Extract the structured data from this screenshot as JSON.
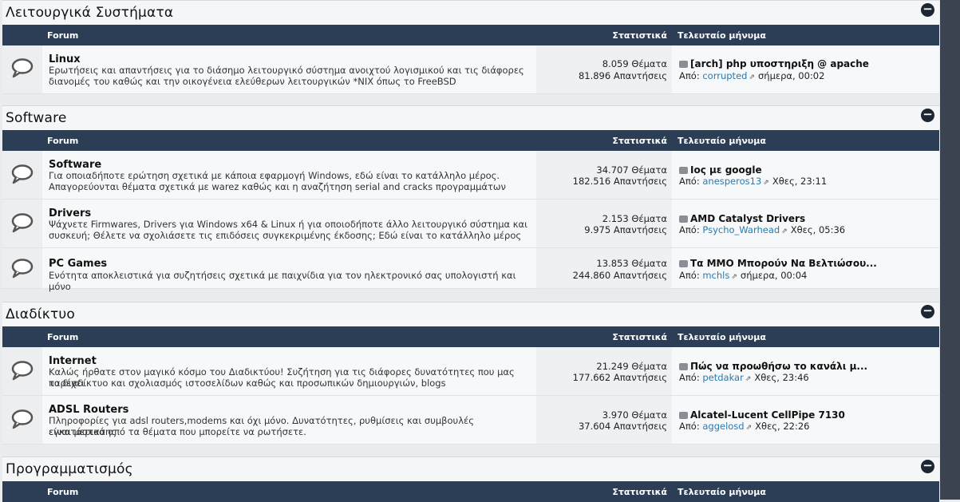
{
  "header_cols": {
    "forum": "Forum",
    "stats": "Στατιστικά",
    "last": "Τελευταίο μήνυμα"
  },
  "last_prefix": "Από:",
  "categories": [
    {
      "title": "Λειτουργικά Συστήματα",
      "forums": [
        {
          "title": "Linux",
          "desc1": "Ερωτήσεις και απαντήσεις για το διάσημο λειτουργικό σύστημα ανοιχτού λογισμικού και τις διάφορες",
          "desc2": "διανομές του καθώς και την οικογένεια ελεύθερων λειτουργικών *NIX όπως το FreeBSD",
          "threads": "8.059 Θέματα",
          "replies": "81.896 Απαντήσεις",
          "last_title": "[arch] php υποστηριξη @ apache",
          "last_user": "corrupted",
          "last_time": "σήμερα, 00:02"
        }
      ]
    },
    {
      "title": "Software",
      "forums": [
        {
          "title": "Software",
          "desc1": "Για οποιαδήποτε ερώτηση σχετικά με κάποια εφαρμογή Windows, εδώ είναι το κατάλληλο μέρος.",
          "desc2": "Απαγορεύονται θέματα σχετικά με warez καθώς και η αναζήτηση serial and cracks προγραμμάτων",
          "threads": "34.707 Θέματα",
          "replies": "182.516 Απαντήσεις",
          "last_title": "Ιος με google",
          "last_user": "anesperos13",
          "last_time": "Χθες, 23:11"
        },
        {
          "title": "Drivers",
          "desc1": "Ψάχνετε Firmwares, Drivers για Windows x64 & Linux ή για οποιοδήποτε άλλο λειτουργικό σύστημα και",
          "desc2": "συσκευή; Θέλετε να σχολιάσετε τις επιδόσεις συγκεκριμένης έκδοσης; Εδώ είναι το κατάλληλο μέρος",
          "threads": "2.153 Θέματα",
          "replies": "9.975 Απαντήσεις",
          "last_title": "AMD Catalyst Drivers",
          "last_user": "Psycho_Warhead",
          "last_time": "Χθες, 05:36"
        },
        {
          "title": "PC Games",
          "desc1": "Ενότητα αποκλειστικά για συζητήσεις σχετικά με παιχνίδια για τον ηλεκτρονικό σας υπολογιστή και μόνο",
          "desc2": "",
          "threads": "13.853 Θέματα",
          "replies": "244.860 Απαντήσεις",
          "last_title": "Τα ΜΜΟ Μπορούν Να Βελτιώσου...",
          "last_user": "mchls",
          "last_time": "σήμερα, 00:04"
        }
      ]
    },
    {
      "title": "Διαδίκτυο",
      "forums": [
        {
          "title": "Internet",
          "desc1": "Καλώς ήρθατε στον μαγικό κόσμο του Διαδικτύου! Συζήτηση για τις διάφορες δυνατότητες που μας παρέχει",
          "desc2": "το διαδίκτυο και σχολιασμός ιστοσελίδων καθώς και προσωπικών δημιουργιών, blogs",
          "threads": "21.249 Θέματα",
          "replies": "177.662 Απαντήσεις",
          "last_title": "Πώς να προωθήσω το κανάλι μ...",
          "last_user": "petdakar",
          "last_time": "Χθες, 23:46"
        },
        {
          "title": "ADSL Routers",
          "desc1": "Πληροφορίες για adsl routers,modems και όχι μόνο. Δυνατότητες, ρυθμίσεις και συμβουλές εγκατάστασης",
          "desc2": "είναι μερικά από τα θέματα που μπορείτε να ρωτήσετε.",
          "threads": "3.970 Θέματα",
          "replies": "37.604 Απαντήσεις",
          "last_title": "Alcatel-Lucent CellPipe 7130",
          "last_user": "aggelosd",
          "last_time": "Χθες, 22:26"
        }
      ]
    },
    {
      "title": "Προγραμματισμός",
      "forums": []
    }
  ]
}
